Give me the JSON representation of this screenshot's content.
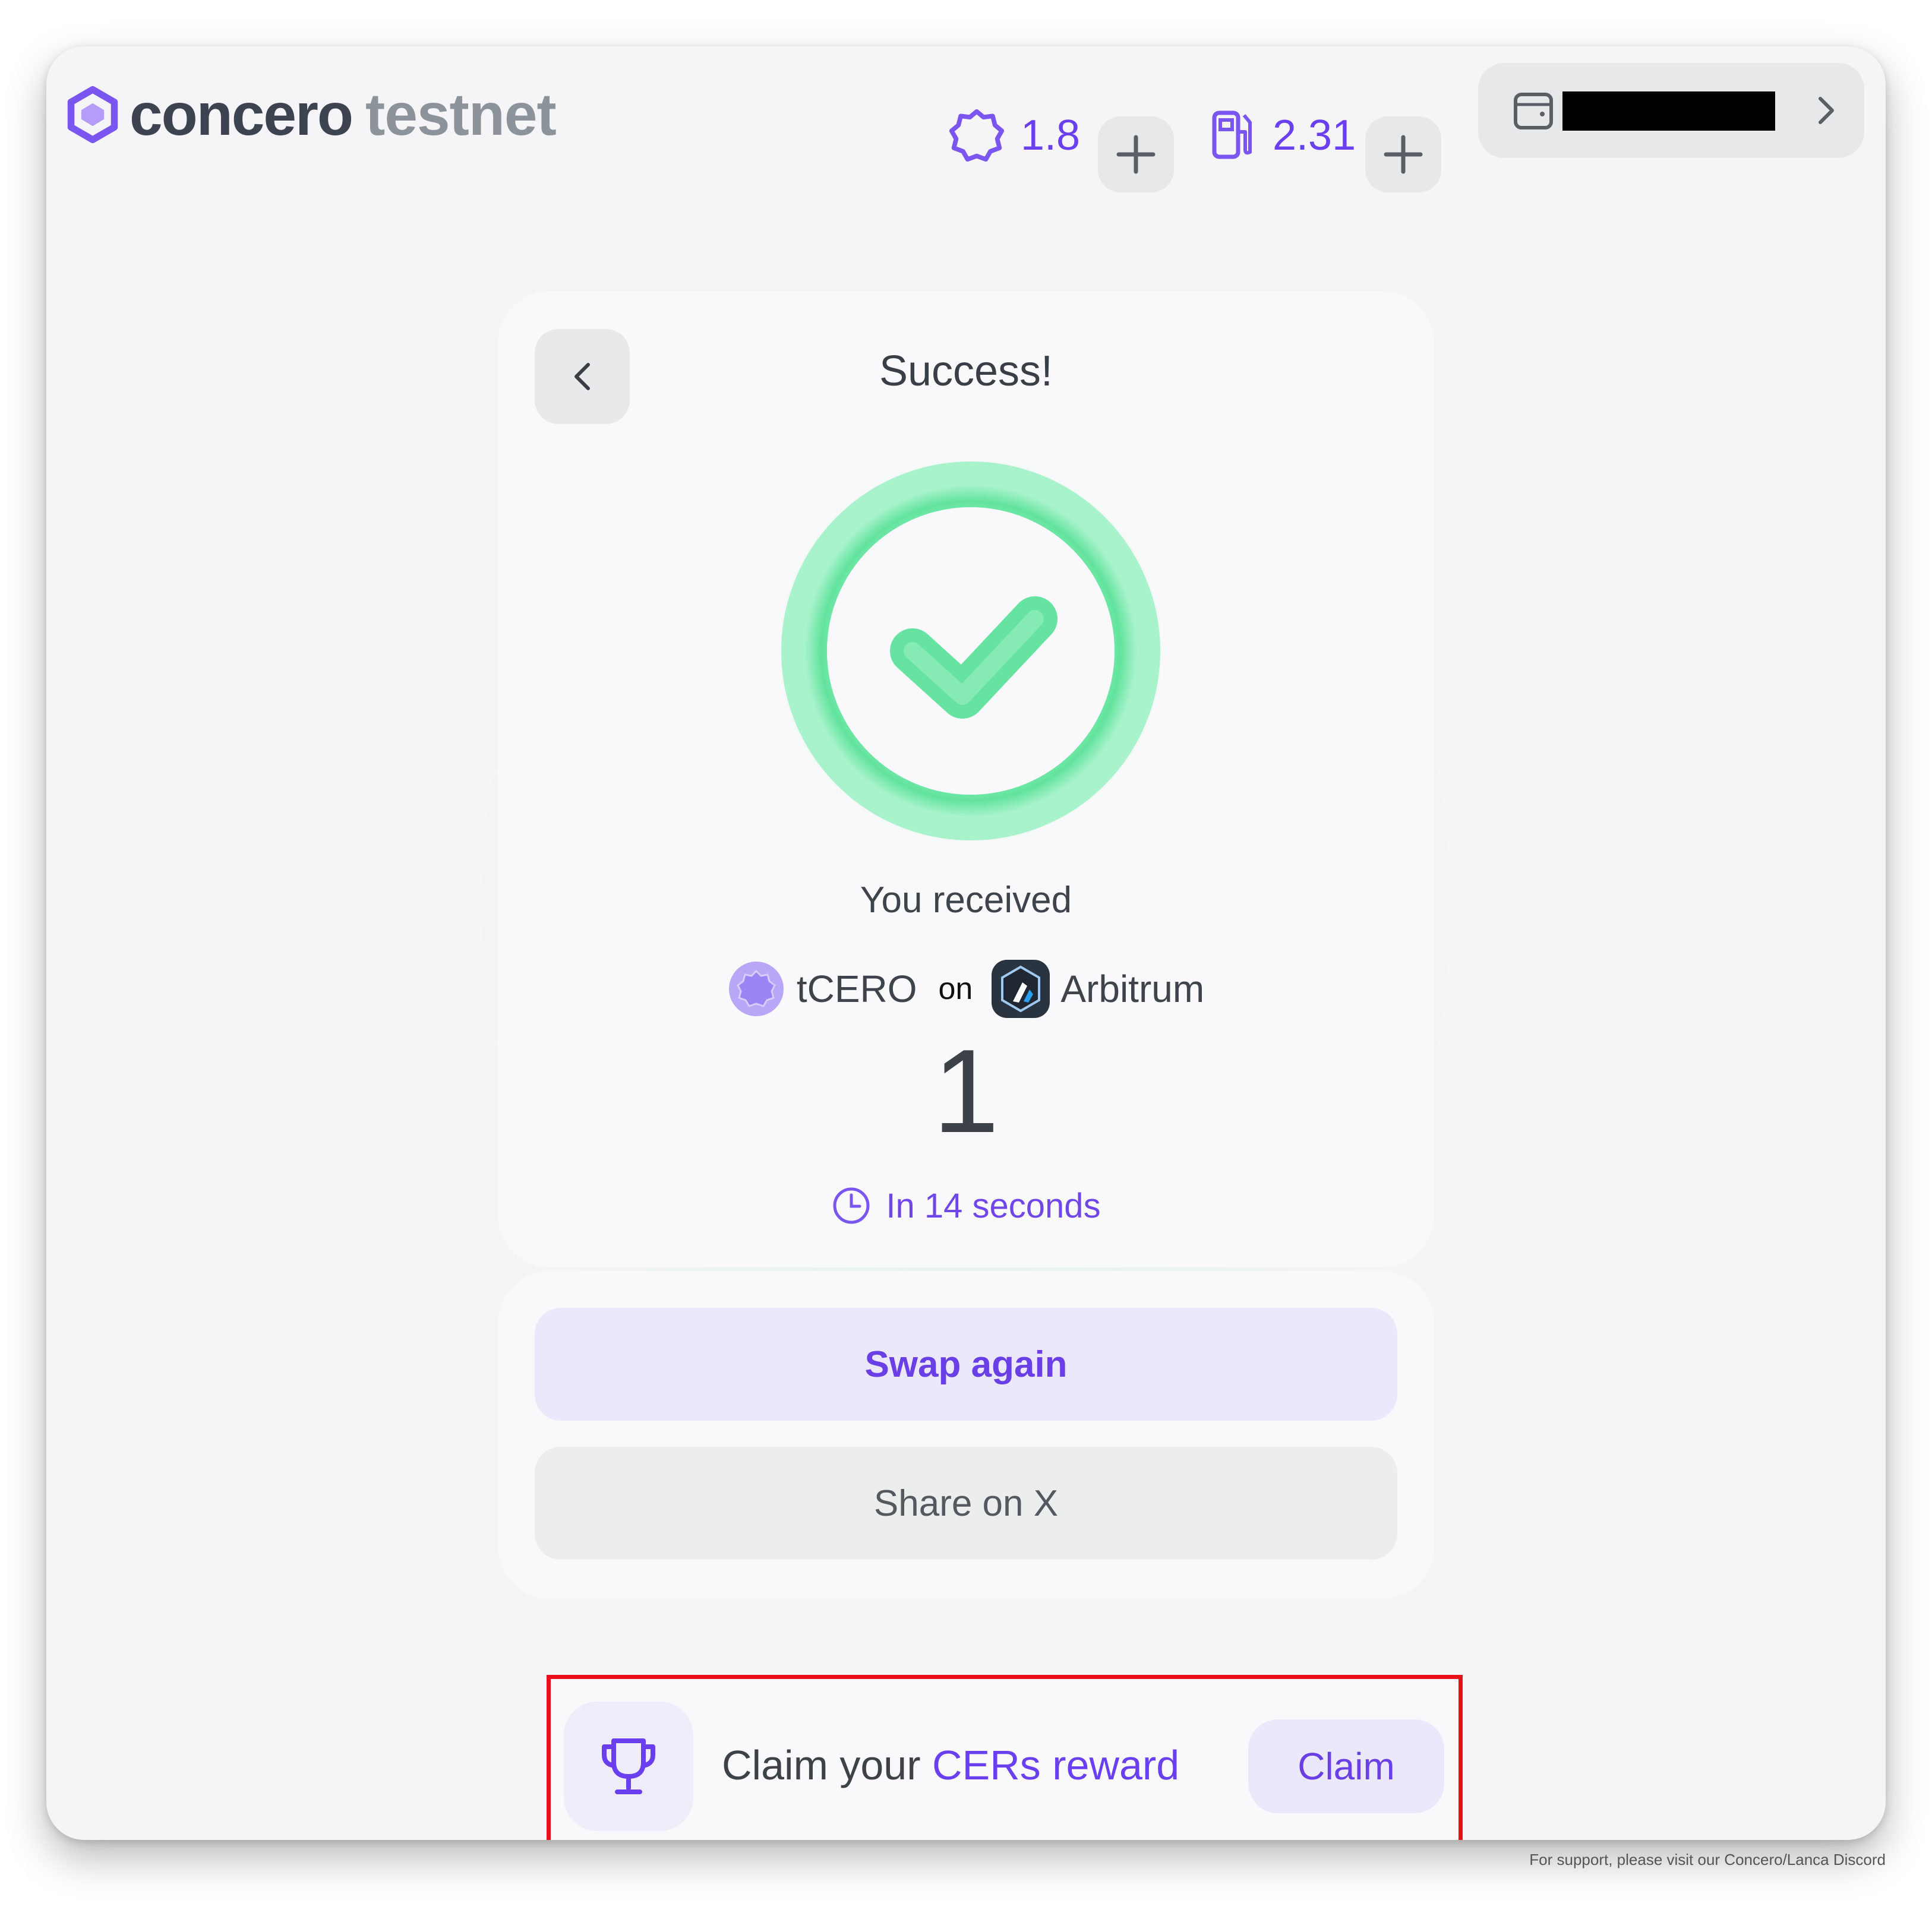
{
  "header": {
    "logo_word": "concero",
    "logo_suffix": "testnet",
    "cer_balance": "1.8",
    "gas_balance": "2.31",
    "wallet_address": ""
  },
  "success_card": {
    "title": "Success!",
    "received_label": "You received",
    "token": "tCERO",
    "on_label": "on",
    "chain": "Arbitrum",
    "amount": "1",
    "eta": "In 14 seconds"
  },
  "actions": {
    "swap_again": "Swap again",
    "share": "Share on X"
  },
  "reward": {
    "text_prefix": "Claim your ",
    "text_accent": "CERs reward",
    "claim_label": "Claim"
  },
  "footer": {
    "support_text": "For support, please visit our Concero/Lanca Discord"
  },
  "colors": {
    "accent": "#6a3ff0",
    "success_green": "#5ee39a",
    "highlight_red": "#e8111b"
  }
}
